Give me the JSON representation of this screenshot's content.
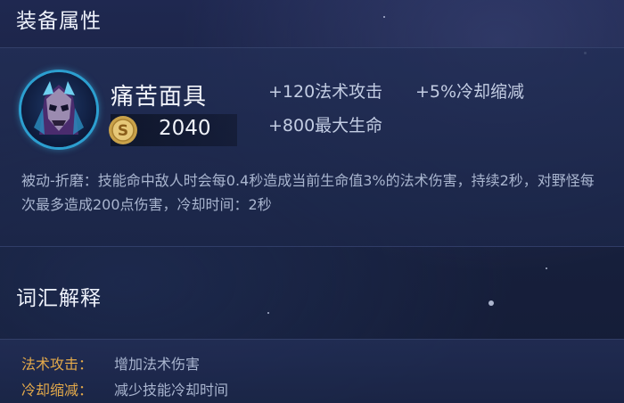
{
  "sections": {
    "attributes_title": "装备属性",
    "glossary_title": "词汇解释"
  },
  "item": {
    "name": "痛苦面具",
    "price": "2040",
    "icon": "mask-of-agony-icon",
    "stats": [
      "+120法术攻击",
      "+5%冷却缩减",
      "+800最大生命"
    ],
    "description": "被动-折磨：技能命中敌人时会每0.4秒造成当前生命值3%的法术伤害，持续2秒，对野怪每次最多造成200点伤害，冷却时间：2秒"
  },
  "glossary": [
    {
      "term": "法术攻击：",
      "definition": "增加法术伤害"
    },
    {
      "term": "冷却缩减：",
      "definition": "减少技能冷却时间"
    }
  ],
  "colors": {
    "background": "#18213f",
    "panel": "#222e56",
    "accent_term": "#e3a94a",
    "icon_ring": "#2c9fd0",
    "coin": "#c9a24a"
  }
}
